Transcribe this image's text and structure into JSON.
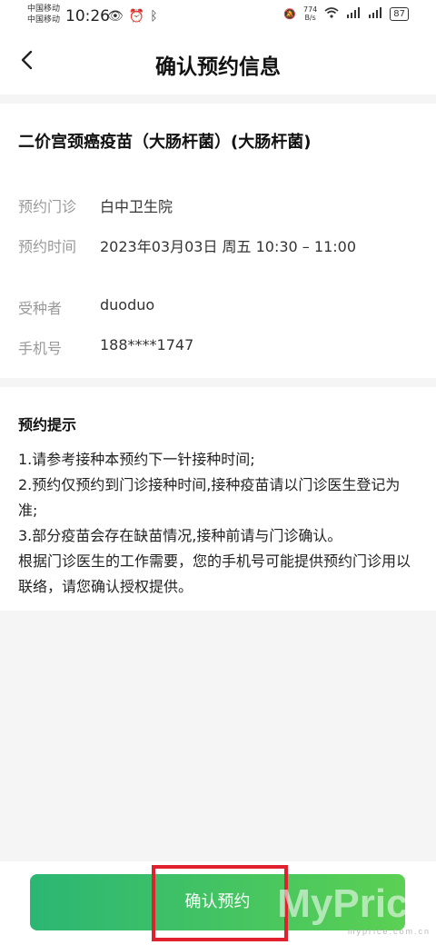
{
  "status": {
    "carrier1": "中国移动",
    "carrier2": "中国移动",
    "time": "10:26",
    "speed_value": "774",
    "speed_unit": "B/s",
    "battery": "87"
  },
  "nav": {
    "title": "确认预约信息"
  },
  "appointment": {
    "vaccine": "二价宫颈癌疫苗（大肠杆菌）(大肠杆菌)",
    "clinic_label": "预约门诊",
    "clinic_value": "白中卫生院",
    "time_label": "预约时间",
    "time_value": "2023年03月03日 周五 10:30 – 11:00",
    "recipient_label": "受种者",
    "recipient_value": "duoduo",
    "phone_label": "手机号",
    "phone_value": "188****1747"
  },
  "tips": {
    "title": "预约提示",
    "lines": [
      "1.请参考接种本预约下一针接种时间;",
      "2.预约仅预约到门诊接种时间,接种疫苗请以门诊医生登记为准;",
      "3.部分疫苗会存在缺苗情况,接种前请与门诊确认。",
      "根据门诊医生的工作需要，您的手机号可能提供预约门诊用以联络，请您确认授权提供。"
    ]
  },
  "actions": {
    "confirm": "确认预约"
  },
  "watermark": {
    "brand": "MyPrice",
    "url": "myprice.com.cn"
  }
}
